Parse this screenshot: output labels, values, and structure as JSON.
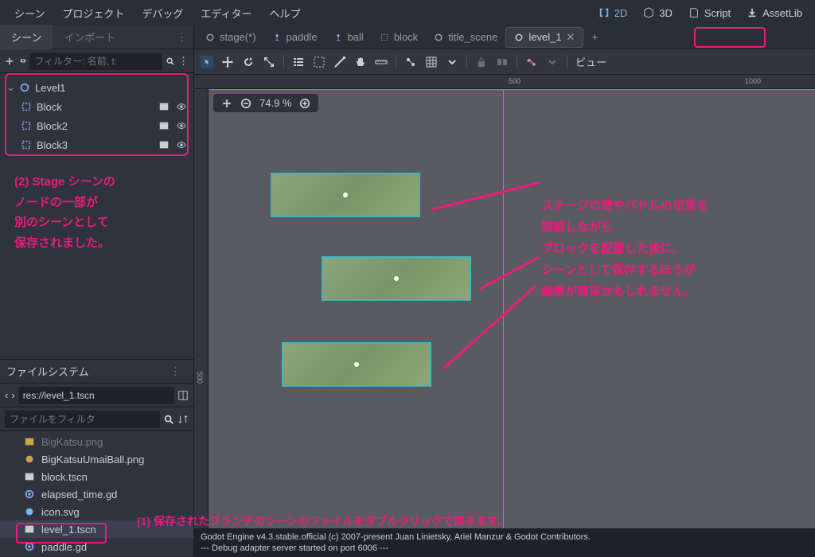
{
  "menubar": {
    "items": [
      "シーン",
      "プロジェクト",
      "デバッグ",
      "エディター",
      "ヘルプ"
    ],
    "views": {
      "v2d": "2D",
      "v3d": "3D",
      "script": "Script",
      "assetlib": "AssetLib"
    }
  },
  "scene_panel": {
    "tabs": {
      "scene": "シーン",
      "import": "インポート"
    },
    "filter_placeholder": "フィルター: 名前, t:",
    "tree": [
      {
        "name": "Level1",
        "icon": "node2d"
      },
      {
        "name": "Block",
        "icon": "instance"
      },
      {
        "name": "Block2",
        "icon": "instance"
      },
      {
        "name": "Block3",
        "icon": "instance"
      }
    ]
  },
  "annotation_left": {
    "l1": "(2) Stage シーンの",
    "l2": "ノードの一部が",
    "l3": "別のシーンとして",
    "l4": "保存されました。"
  },
  "filesystem": {
    "title": "ファイルシステム",
    "path": "res://level_1.tscn",
    "filter_placeholder": "ファイルをフィルタ",
    "files": [
      {
        "name": "BigKatsu.png",
        "icon": "img"
      },
      {
        "name": "BigKatsuUmaiBall.png",
        "icon": "img"
      },
      {
        "name": "block.tscn",
        "icon": "scene"
      },
      {
        "name": "elapsed_time.gd",
        "icon": "gd"
      },
      {
        "name": "icon.svg",
        "icon": "svg"
      },
      {
        "name": "level_1.tscn",
        "icon": "scene",
        "selected": true
      },
      {
        "name": "paddle.gd",
        "icon": "gd"
      }
    ]
  },
  "doc_tabs": [
    {
      "label": "stage(*)",
      "active": false
    },
    {
      "label": "paddle",
      "active": false
    },
    {
      "label": "ball",
      "active": false
    },
    {
      "label": "block",
      "active": false
    },
    {
      "label": "title_scene",
      "active": false
    },
    {
      "label": "level_1",
      "active": true
    }
  ],
  "viewport": {
    "zoom": "74.9 %",
    "view_label": "ビュー",
    "ruler_h": [
      "500",
      "1000"
    ],
    "ruler_v": [
      "500"
    ]
  },
  "callout_right": {
    "l1": "ステージの壁やパドルの位置を",
    "l2": "確認しながら",
    "l3": "ブロックを配置した後に、",
    "l4": "シーンとして保存するほうが",
    "l5": "編集が簡単かもしれません。"
  },
  "callout_bottom": "(1) 保存されたブランチのシーンのファイルをダブルクリックで開きます。",
  "output": {
    "l1": "Godot Engine v4.3.stable.official (c) 2007-present Juan Linietsky, Ariel Manzur & Godot Contributors.",
    "l2": "--- Debug adapter server started on port 6006 ---"
  }
}
